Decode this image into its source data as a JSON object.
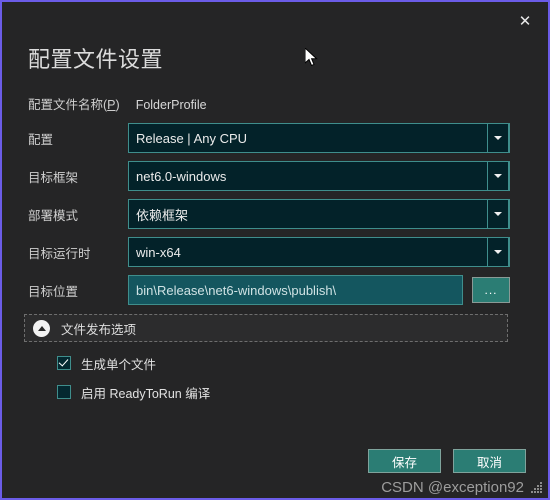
{
  "dialog": {
    "title": "配置文件设置",
    "close_label": "✕"
  },
  "profile": {
    "label_prefix": "配置文件名称(",
    "label_accel": "P",
    "label_suffix": ")",
    "name": "FolderProfile"
  },
  "fields": [
    {
      "label": "配置",
      "value": "Release | Any CPU",
      "type": "combo"
    },
    {
      "label": "目标框架",
      "value": "net6.0-windows",
      "type": "combo"
    },
    {
      "label": "部署模式",
      "value": "依赖框架",
      "type": "combo"
    },
    {
      "label": "目标运行时",
      "value": "win-x64",
      "type": "combo"
    }
  ],
  "target_location": {
    "label": "目标位置",
    "value": "bin\\Release\\net6-windows\\publish\\",
    "browse_label": "..."
  },
  "expander": {
    "label": "文件发布选项",
    "expanded": true
  },
  "options": [
    {
      "label": "生成单个文件",
      "checked": true
    },
    {
      "label": "启用 ReadyToRun 编译",
      "checked": false
    }
  ],
  "footer": {
    "save_label": "保存",
    "cancel_label": "取消"
  },
  "watermark": {
    "text": "CSDN @exception92"
  },
  "colors": {
    "dialog_bg": "#252526",
    "dialog_border": "#6b5ce7",
    "combo_bg": "#032229",
    "combo_border": "#3f8e8c",
    "path_bg": "#14565f",
    "button_bg": "#2b7d74",
    "button_border": "#7fa39c",
    "text": "#dcdcdc"
  }
}
